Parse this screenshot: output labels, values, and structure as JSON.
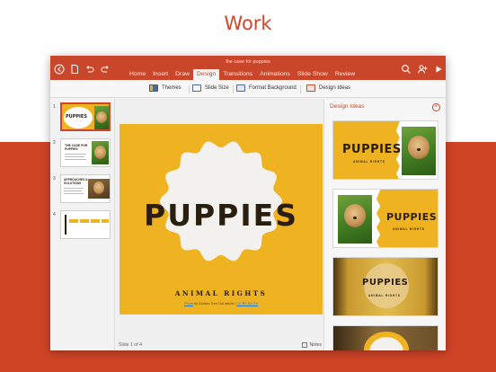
{
  "hero": {
    "title": "Work"
  },
  "app": {
    "document_title": "the case for puppies",
    "tabs": [
      "Home",
      "Insert",
      "Draw",
      "Design",
      "Transitions",
      "Animations",
      "Slide Show",
      "Review"
    ],
    "active_tab": "Design",
    "icons": {
      "back": "back-arrow-icon",
      "file": "file-icon",
      "undo": "undo-icon",
      "redo": "redo-icon",
      "search": "search-icon",
      "share": "add-person-icon",
      "play": "play-icon"
    }
  },
  "ribbon": {
    "themes": "Themes",
    "slide_size": "Slide Size",
    "format_background": "Format Background",
    "design_ideas": "Design Ideas"
  },
  "thumbnails": {
    "numbers": [
      "1",
      "2",
      "3",
      "4"
    ],
    "slide1_title": "PUPPIES",
    "slide2_title": "THE CASE FOR PUPPIES",
    "slide3_title": "APPROACHES & SOLUTIONS"
  },
  "slide": {
    "title": "PUPPIES",
    "subtitle": "ANIMAL RIGHTS",
    "credit_link": "Photo",
    "credit_text": " by Golden Tree Gal article / ",
    "credit_license": "CC BY-SA 2.0",
    "background_color": "#efb321"
  },
  "status": {
    "slide_of": "Slide 1 of 4",
    "notes": "Notes"
  },
  "design_ideas": {
    "header": "Design Ideas",
    "options": [
      {
        "title": "PUPPIES",
        "subtitle": "ANIMAL RIGHTS"
      },
      {
        "title": "PUPPIES",
        "subtitle": "ANIMAL RIGHTS"
      },
      {
        "title": "PUPPIES",
        "subtitle": "ANIMAL RIGHTS"
      },
      {
        "title": "",
        "subtitle": ""
      }
    ]
  },
  "colors": {
    "brand": "#d04426",
    "accent_yellow": "#efb321"
  }
}
